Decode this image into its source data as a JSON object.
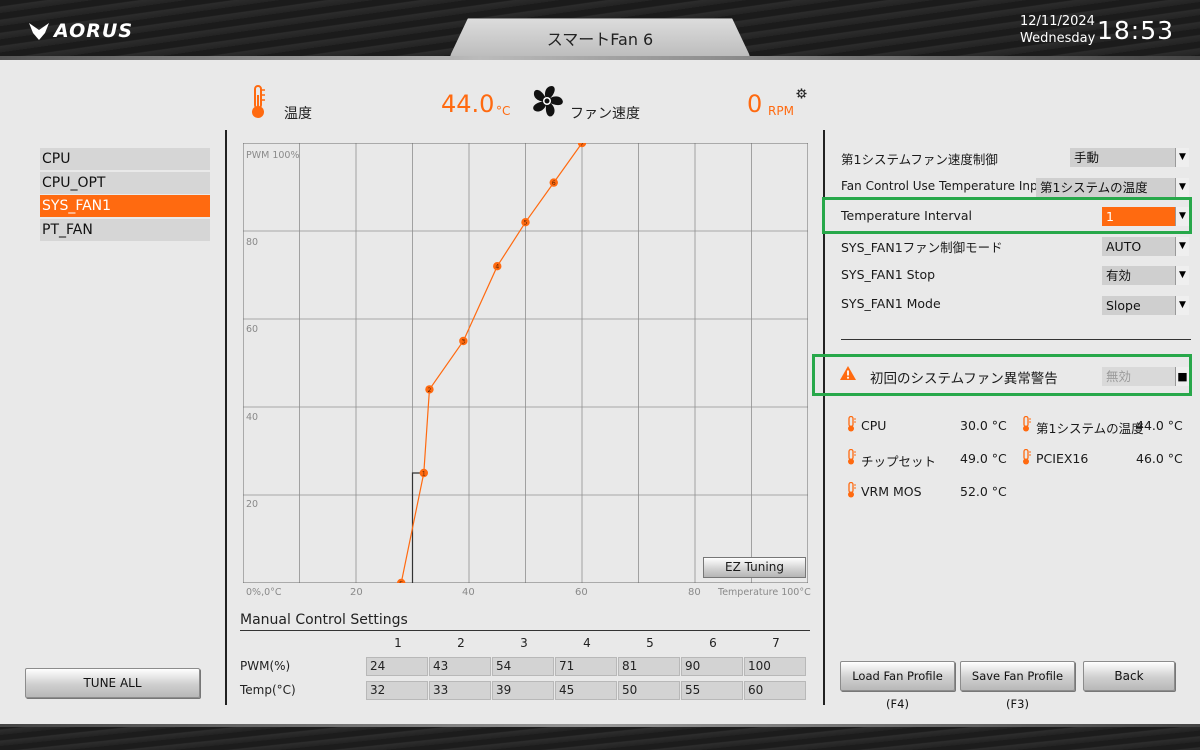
{
  "brand": "AORUS",
  "page_title": "スマートFan 6",
  "datetime": {
    "date": "12/11/2024",
    "weekday": "Wednesday",
    "time": "18:53"
  },
  "fans": [
    {
      "label": "CPU",
      "selected": false
    },
    {
      "label": "CPU_OPT",
      "selected": false
    },
    {
      "label": "SYS_FAN1",
      "selected": true
    },
    {
      "label": "PT_FAN",
      "selected": false
    }
  ],
  "tune_all_label": "TUNE ALL",
  "header": {
    "temp_label": "温度",
    "temp_value": "44.0",
    "temp_unit": "°C",
    "fan_label": "ファン速度",
    "fan_value": "0",
    "fan_unit": "RPM"
  },
  "graph": {
    "y_top_label": "PWM 100%",
    "y_ticks": [
      "80",
      "60",
      "40",
      "20"
    ],
    "origin_label": "0%,0°C",
    "x_ticks": [
      "20",
      "40",
      "60",
      "80"
    ],
    "x_end_label": "Temperature 100°C",
    "ez_tuning_label": "EZ Tuning",
    "points": [
      {
        "temp": 28,
        "pwm": 0
      },
      {
        "temp": 32,
        "pwm": 25
      },
      {
        "temp": 33,
        "pwm": 44
      },
      {
        "temp": 39,
        "pwm": 55
      },
      {
        "temp": 45,
        "pwm": 72
      },
      {
        "temp": 50,
        "pwm": 82
      },
      {
        "temp": 55,
        "pwm": 91
      },
      {
        "temp": 60,
        "pwm": 100
      }
    ],
    "current_temp": 30,
    "accent": "#ff6a10"
  },
  "manual": {
    "title": "Manual Control Settings",
    "columns": [
      "1",
      "2",
      "3",
      "4",
      "5",
      "6",
      "7"
    ],
    "pwm_label": "PWM(%)",
    "temp_label": "Temp(°C)",
    "pwm": [
      "24",
      "43",
      "54",
      "71",
      "81",
      "90",
      "100"
    ],
    "temp": [
      "32",
      "33",
      "39",
      "45",
      "50",
      "55",
      "60"
    ]
  },
  "settings": [
    {
      "label": "第1システムファン速度制御",
      "value": "手動"
    },
    {
      "label": "Fan Control Use Temperature Input",
      "value": "第1システムの温度"
    },
    {
      "label": "Temperature Interval",
      "value": "1"
    },
    {
      "label": "SYS_FAN1ファン制御モード",
      "value": "AUTO"
    },
    {
      "label": "SYS_FAN1 Stop",
      "value": "有効"
    },
    {
      "label": "SYS_FAN1 Mode",
      "value": "Slope"
    }
  ],
  "warning": {
    "label": "初回のシステムファン異常警告",
    "value": "無効"
  },
  "temps": [
    {
      "label": "CPU",
      "value": "30.0 °C"
    },
    {
      "label": "第1システムの温度",
      "value": "44.0 °C"
    },
    {
      "label": "チップセット",
      "value": "49.0 °C"
    },
    {
      "label": "PCIEX16",
      "value": "46.0 °C"
    },
    {
      "label": "VRM MOS",
      "value": "52.0 °C"
    }
  ],
  "buttons": {
    "load": "Load Fan Profile (F4)",
    "save": "Save Fan Profile (F3)",
    "back": "Back"
  },
  "colors": {
    "accent": "#ff6a10",
    "highlight_box": "#27a84a"
  }
}
